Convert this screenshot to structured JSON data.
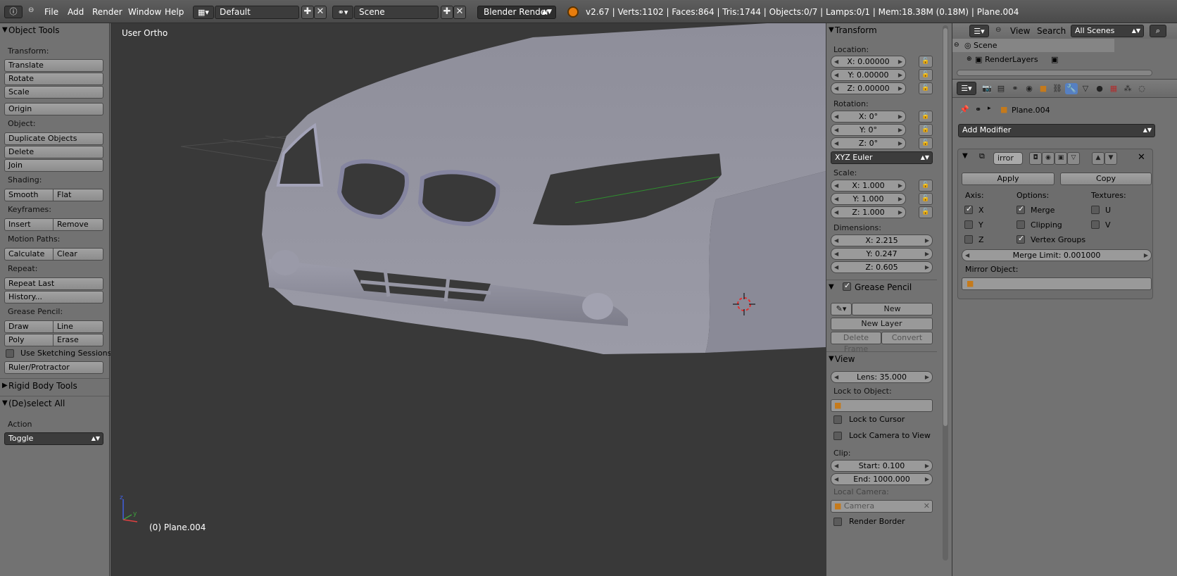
{
  "header": {
    "menu": [
      "File",
      "Add",
      "Render",
      "Window",
      "Help"
    ],
    "screen_layout": "Default",
    "scene": "Scene",
    "render_engine": "Blender Render",
    "stats": "v2.67 | Verts:1102 | Faces:864 | Tris:1744 | Objects:0/7 | Lamps:0/1 | Mem:18.38M (0.18M) | Plane.004",
    "add_glyph": "✚",
    "close_glyph": "✕"
  },
  "toolshelf": {
    "title": "Object Tools",
    "transform_label": "Transform:",
    "translate": "Translate",
    "rotate": "Rotate",
    "scale": "Scale",
    "origin": "Origin",
    "object_label": "Object:",
    "duplicate": "Duplicate Objects",
    "delete": "Delete",
    "join": "Join",
    "shading_label": "Shading:",
    "smooth": "Smooth",
    "flat": "Flat",
    "keyframes_label": "Keyframes:",
    "insert": "Insert",
    "remove": "Remove",
    "motion_label": "Motion Paths:",
    "calculate": "Calculate",
    "clear": "Clear",
    "repeat_label": "Repeat:",
    "repeat_last": "Repeat Last",
    "history": "History...",
    "grease_label": "Grease Pencil:",
    "draw": "Draw",
    "line": "Line",
    "poly": "Poly",
    "erase": "Erase",
    "sketching": "Use Sketching Sessions",
    "ruler": "Ruler/Protractor",
    "rigid_body": "Rigid Body Tools",
    "deselect_all": "(De)select All",
    "action_label": "Action",
    "action_value": "Toggle"
  },
  "viewport": {
    "view_name": "User Ortho",
    "object_info": "(0) Plane.004",
    "colors": {
      "background": "#393939",
      "mesh": "#8f8f9c"
    }
  },
  "npanel": {
    "transform_title": "Transform",
    "location_label": "Location:",
    "loc_x": "X: 0.00000",
    "loc_y": "Y: 0.00000",
    "loc_z": "Z: 0.00000",
    "rotation_label": "Rotation:",
    "rot_x": "X: 0°",
    "rot_y": "Y: 0°",
    "rot_z": "Z: 0°",
    "rot_mode": "XYZ Euler",
    "scale_label": "Scale:",
    "scl_x": "X: 1.000",
    "scl_y": "Y: 1.000",
    "scl_z": "Z: 1.000",
    "dimensions_label": "Dimensions:",
    "dim_x": "X: 2.215",
    "dim_y": "Y: 0.247",
    "dim_z": "Z: 0.605",
    "grease_title": "Grease Pencil",
    "gp_new": "New",
    "gp_new_layer": "New Layer",
    "gp_delete_frame": "Delete Frame",
    "gp_convert": "Convert",
    "view_title": "View",
    "lens": "Lens: 35.000",
    "lock_object_label": "Lock to Object:",
    "lock_cursor": "Lock to Cursor",
    "lock_camera": "Lock Camera to View",
    "clip_label": "Clip:",
    "clip_start": "Start: 0.100",
    "clip_end": "End: 1000.000",
    "local_camera_label": "Local Camera:",
    "local_camera_value": "Camera",
    "render_border": "Render Border"
  },
  "outliner": {
    "menu_view": "View",
    "menu_search": "Search",
    "filter": "All Scenes",
    "rows": [
      "Scene",
      "RenderLayers"
    ]
  },
  "properties": {
    "object_name": "Plane.004",
    "add_modifier": "Add Modifier",
    "modifier_name": "irror",
    "apply": "Apply",
    "copy": "Copy",
    "axis_label": "Axis:",
    "options_label": "Options:",
    "textures_label": "Textures:",
    "axis_x": "X",
    "axis_y": "Y",
    "axis_z": "Z",
    "merge": "Merge",
    "clipping": "Clipping",
    "vertex_groups": "Vertex Groups",
    "tex_u": "U",
    "tex_v": "V",
    "merge_limit": "Merge Limit: 0.001000",
    "mirror_object_label": "Mirror Object:"
  }
}
